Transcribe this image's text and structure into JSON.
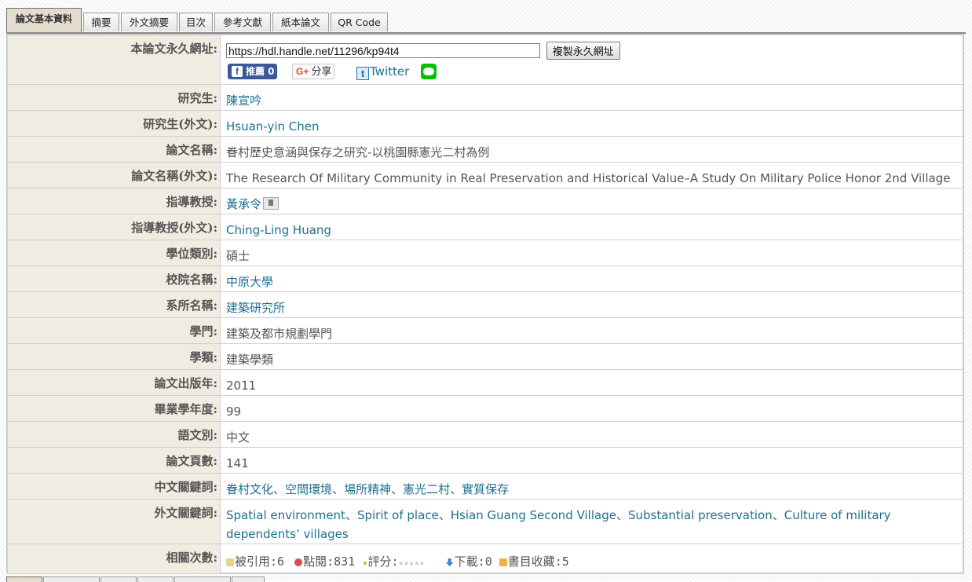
{
  "tabs": [
    {
      "label": "論文基本資料",
      "active": true
    },
    {
      "label": "摘要",
      "active": false
    },
    {
      "label": "外文摘要",
      "active": false
    },
    {
      "label": "目次",
      "active": false
    },
    {
      "label": "參考文獻",
      "active": false
    },
    {
      "label": "紙本論文",
      "active": false
    },
    {
      "label": "QR Code",
      "active": false
    }
  ],
  "permalink": {
    "label": "本論文永久網址:",
    "url": "https://hdl.handle.net/11296/kp94t4",
    "copy_button": "複製永久網址",
    "share": {
      "facebook": "推薦 0",
      "google": "分享",
      "twitter": "Twitter"
    }
  },
  "rows": [
    {
      "label": "研究生:",
      "value": "陳宣吟",
      "link": true
    },
    {
      "label": "研究生(外文):",
      "value": "Hsuan-yin Chen",
      "link": true
    },
    {
      "label": "論文名稱:",
      "value": "眷村歷史意涵與保存之研究-以桃園縣憲光二村為例",
      "link": false
    },
    {
      "label": "論文名稱(外文):",
      "value": "The Research Of Military Community in Real Preservation and Historical Value–A Study On Military Police Honor 2nd Village",
      "link": false
    },
    {
      "label": "指導教授:",
      "value": "黃承令",
      "link": true
    },
    {
      "label": "指導教授(外文):",
      "value": "Ching-Ling Huang",
      "link": true
    },
    {
      "label": "學位類別:",
      "value": "碩士",
      "link": false
    },
    {
      "label": "校院名稱:",
      "value": "中原大學",
      "link": true
    },
    {
      "label": "系所名稱:",
      "value": "建築研究所",
      "link": true
    },
    {
      "label": "學門:",
      "value": "建築及都市規劃學門",
      "link": false
    },
    {
      "label": "學類:",
      "value": "建築學類",
      "link": false
    },
    {
      "label": "論文出版年:",
      "value": "2011",
      "link": false
    },
    {
      "label": "畢業學年度:",
      "value": "99",
      "link": false
    },
    {
      "label": "語文別:",
      "value": "中文",
      "link": false
    },
    {
      "label": "論文頁數:",
      "value": "141",
      "link": false
    }
  ],
  "keywords_zh": {
    "label": "中文關鍵詞:",
    "items": [
      "眷村文化",
      "空間環境",
      "場所精神",
      "憲光二村",
      "實質保存"
    ]
  },
  "keywords_en": {
    "label": "外文關鍵詞:",
    "items": [
      "Spatial environment",
      "Spirit of place",
      "Hsian Guang Second Village",
      "Substantial preservation",
      "Culture of military dependents’ villages"
    ]
  },
  "stats": {
    "label": "相關次數:",
    "cited": "被引用:6",
    "views": "點閱:831",
    "rating": "評分:",
    "downloads": "下載:0",
    "bookmarks": "書目收藏:5"
  }
}
